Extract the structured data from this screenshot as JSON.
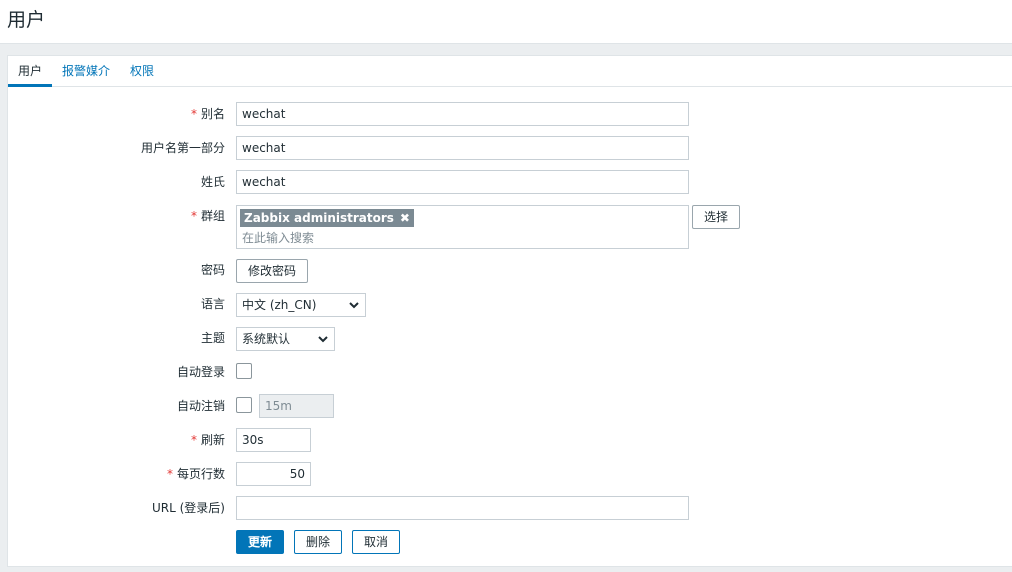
{
  "page": {
    "title": "用户"
  },
  "tabs": [
    {
      "label": "用户"
    },
    {
      "label": "报警媒介"
    },
    {
      "label": "权限"
    }
  ],
  "form": {
    "alias": {
      "label": "别名",
      "value": "wechat"
    },
    "name": {
      "label": "用户名第一部分",
      "value": "wechat"
    },
    "surname": {
      "label": "姓氏",
      "value": "wechat"
    },
    "groups": {
      "label": "群组",
      "chip": "Zabbix administrators",
      "chip_remove": "✖",
      "placeholder": "在此输入搜索",
      "select_label": "选择"
    },
    "password": {
      "label": "密码",
      "button": "修改密码"
    },
    "language": {
      "label": "语言",
      "value": "中文 (zh_CN)"
    },
    "theme": {
      "label": "主题",
      "value": "系统默认"
    },
    "autologin": {
      "label": "自动登录"
    },
    "autologout": {
      "label": "自动注销",
      "value": "15m"
    },
    "refresh": {
      "label": "刷新",
      "value": "30s"
    },
    "rows_per_page": {
      "label": "每页行数",
      "value": "50"
    },
    "url": {
      "label": "URL (登录后)",
      "value": ""
    },
    "required_mark": "*"
  },
  "actions": {
    "update": "更新",
    "delete": "删除",
    "cancel": "取消"
  },
  "colors": {
    "accent": "#0275b8",
    "required": "#e33734",
    "chip": "#7b8a93"
  }
}
